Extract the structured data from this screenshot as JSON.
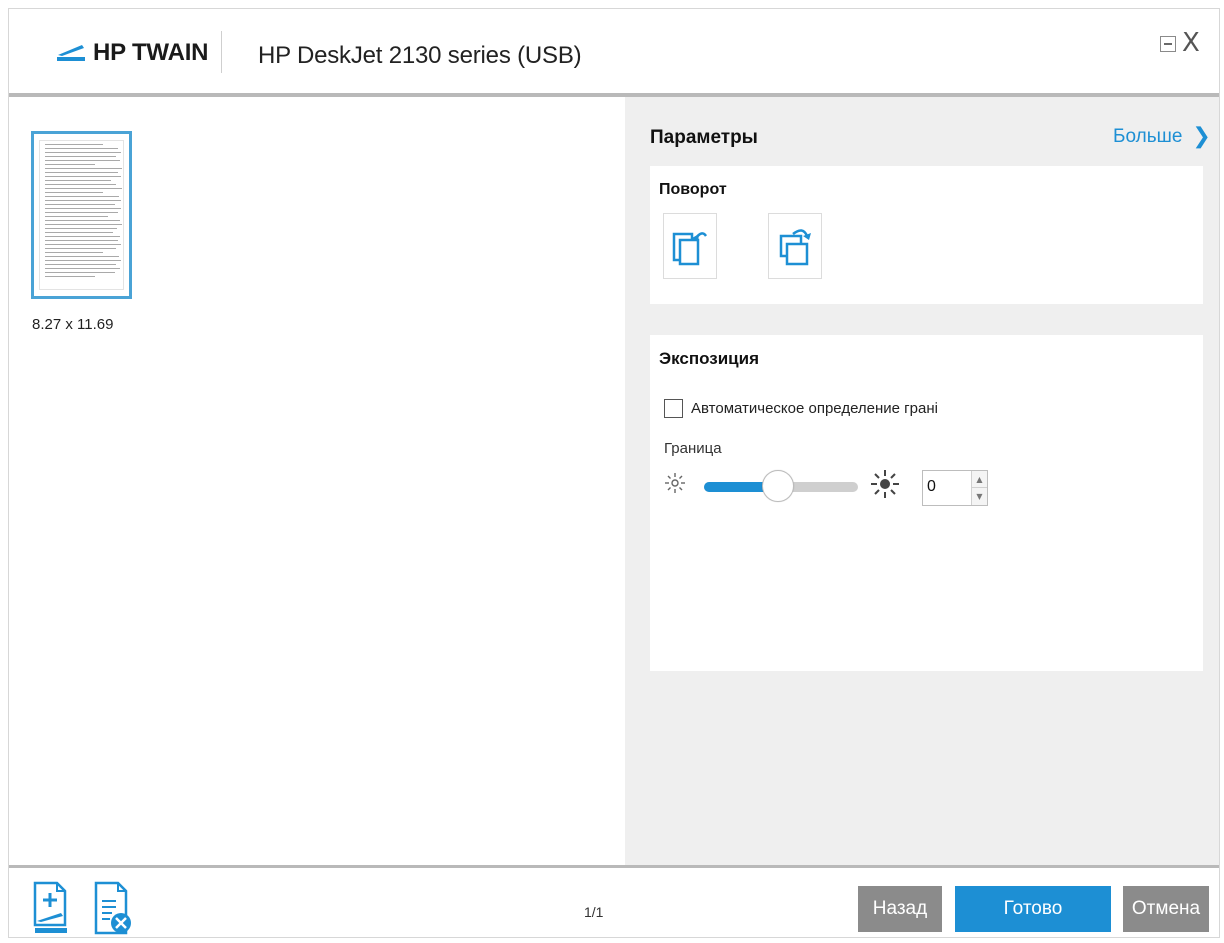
{
  "app": {
    "logo_text": "HP TWAIN",
    "device_title": "HP DeskJet 2130 series (USB)"
  },
  "window_controls": {
    "minimize_icon": "minimize-icon",
    "close_label": "X"
  },
  "preview": {
    "thumbnail_size": "8.27  x  11.69",
    "page_count": "1/1"
  },
  "panel": {
    "title": "Параметры",
    "more_label": "Больше",
    "more_chevron": "❯",
    "rotate": {
      "title": "Поворот",
      "buttons": [
        "rotate-left-icon",
        "rotate-right-icon"
      ]
    },
    "exposure": {
      "title": "Экспозиция",
      "auto_edge_label": "Автоматическое определение грані",
      "auto_edge_checked": false,
      "border_label": "Граница",
      "slider_level": 0.48,
      "value": "0"
    }
  },
  "footer": {
    "back_label": "Назад",
    "done_label": "Готово",
    "cancel_label": "Отмена"
  },
  "colors": {
    "accent": "#1d8fd4",
    "secondary_button": "#8b8b8b",
    "panel_bg": "#efefef"
  }
}
